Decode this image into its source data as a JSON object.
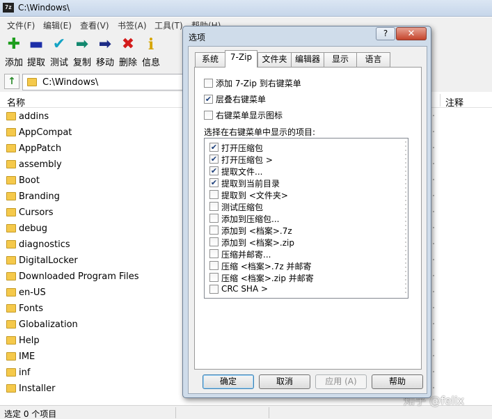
{
  "window": {
    "title": "C:\\Windows\\",
    "icon_text": "7z"
  },
  "menu": [
    {
      "label": "文件(F)"
    },
    {
      "label": "编辑(E)"
    },
    {
      "label": "查看(V)"
    },
    {
      "label": "书签(A)"
    },
    {
      "label": "工具(T)"
    },
    {
      "label": "帮助(H)"
    }
  ],
  "toolbar": [
    {
      "label": "添加",
      "icon": "plus-icon",
      "glyph": "✚",
      "color": "#1e9e1e"
    },
    {
      "label": "提取",
      "icon": "minus-icon",
      "glyph": "▬",
      "color": "#1d2fa8"
    },
    {
      "label": "测试",
      "icon": "check-icon",
      "glyph": "✔",
      "color": "#13a3c4"
    },
    {
      "label": "复制",
      "icon": "copy-arrow-icon",
      "glyph": "➡",
      "color": "#13886f"
    },
    {
      "label": "移动",
      "icon": "move-arrow-icon",
      "glyph": "➡",
      "color": "#1d2c86"
    },
    {
      "label": "删除",
      "icon": "delete-x-icon",
      "glyph": "✖",
      "color": "#d31b1b"
    },
    {
      "label": "信息",
      "icon": "info-icon",
      "glyph": "i",
      "color": "#d6a500"
    }
  ],
  "address": {
    "path": "C:\\Windows\\"
  },
  "columns": {
    "name": "名称",
    "comment": "注释"
  },
  "files": [
    "addins",
    "AppCompat",
    "AppPatch",
    "assembly",
    "Boot",
    "Branding",
    "Cursors",
    "debug",
    "diagnostics",
    "DigitalLocker",
    "Downloaded Program Files",
    "en-US",
    "Fonts",
    "Globalization",
    "Help",
    "IME",
    "inf",
    "Installer"
  ],
  "status": {
    "selected": "选定 0 个项目"
  },
  "watermark": "知乎 @felix",
  "dialog": {
    "title": "选项",
    "help_label": "?",
    "close_label": "✕",
    "tabs": [
      {
        "label": "系统",
        "active": false
      },
      {
        "label": "7-Zip",
        "active": true
      },
      {
        "label": "文件夹",
        "active": false
      },
      {
        "label": "编辑器",
        "active": false
      },
      {
        "label": "显示",
        "active": false
      },
      {
        "label": "语言",
        "active": false
      }
    ],
    "options": [
      {
        "label": "添加 7-Zip 到右键菜单",
        "checked": false
      },
      {
        "label": "层叠右键菜单",
        "checked": true
      },
      {
        "label": "右键菜单显示图标",
        "checked": false
      }
    ],
    "items_caption": "选择在右键菜单中显示的项目:",
    "items": [
      {
        "label": "打开压缩包",
        "checked": true
      },
      {
        "label": "打开压缩包 >",
        "checked": true
      },
      {
        "label": "提取文件...",
        "checked": true
      },
      {
        "label": "提取到当前目录",
        "checked": true
      },
      {
        "label": "提取到 <文件夹>",
        "checked": false
      },
      {
        "label": "测试压缩包",
        "checked": false
      },
      {
        "label": "添加到压缩包...",
        "checked": false
      },
      {
        "label": "添加到 <档案>.7z",
        "checked": false
      },
      {
        "label": "添加到 <档案>.zip",
        "checked": false
      },
      {
        "label": "压缩并邮寄...",
        "checked": false
      },
      {
        "label": "压缩 <档案>.7z 并邮寄",
        "checked": false
      },
      {
        "label": "压缩 <档案>.zip 并邮寄",
        "checked": false
      },
      {
        "label": "CRC SHA >",
        "checked": false
      }
    ],
    "buttons": {
      "ok": "确定",
      "cancel": "取消",
      "apply": "应用 (A)",
      "help": "帮助"
    }
  }
}
